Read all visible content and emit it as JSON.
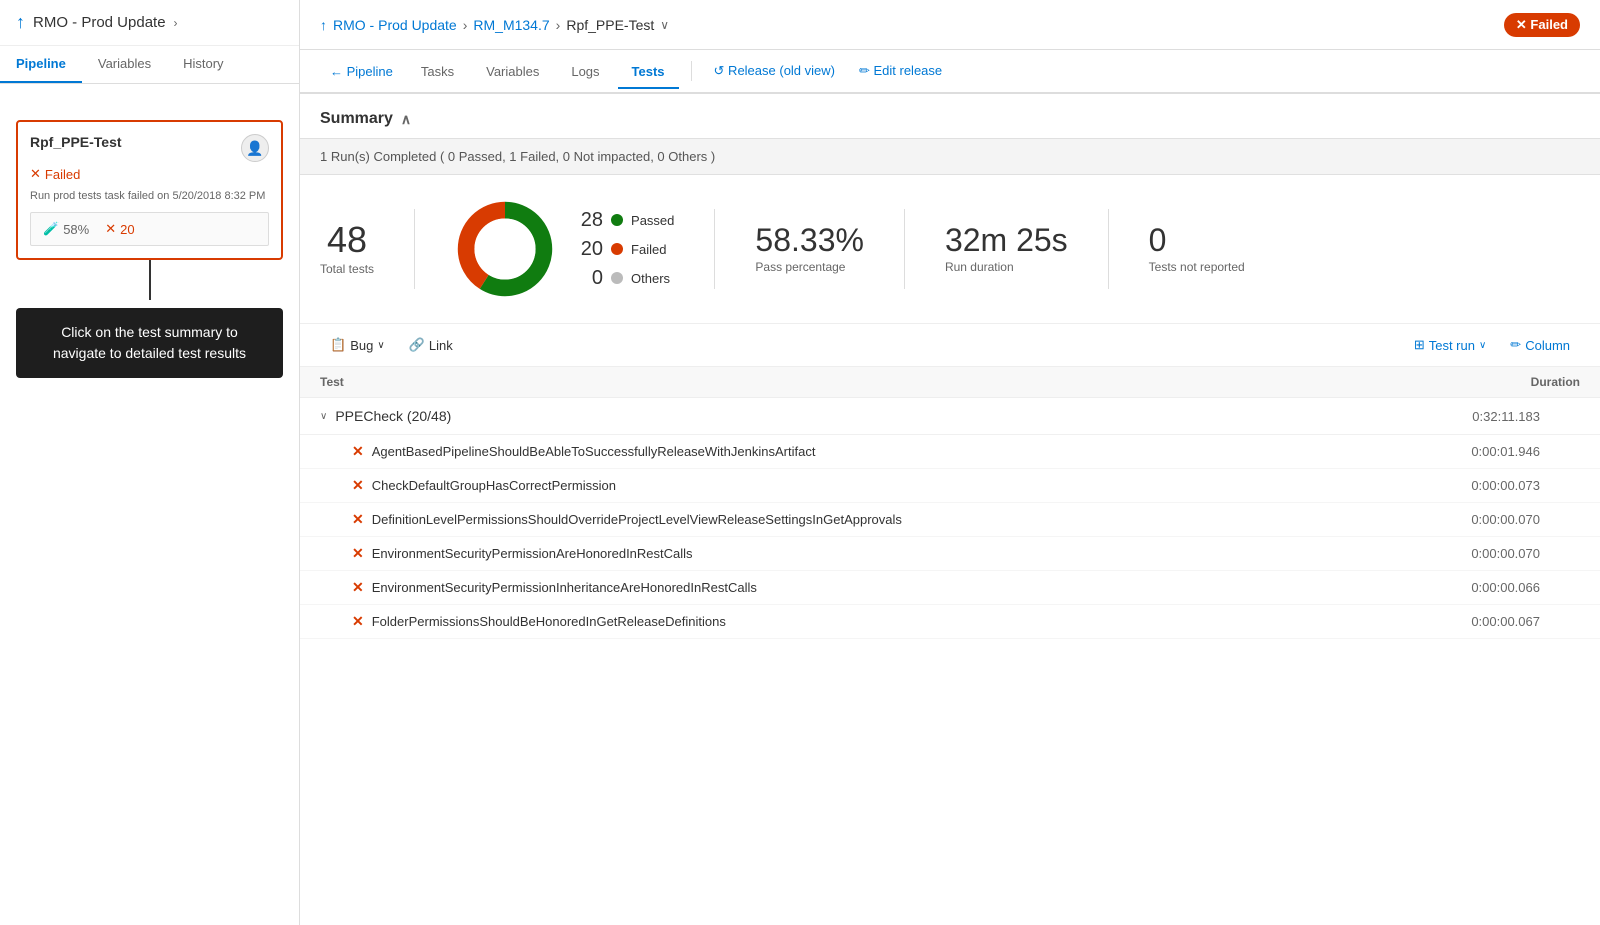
{
  "left": {
    "header_icon": "↑",
    "header_title": "RMO - Prod Update",
    "header_chevron": "›",
    "tabs": [
      "Pipeline",
      "Variables",
      "History"
    ],
    "active_tab": "Pipeline",
    "stage": {
      "name": "Rpf_PPE-Test",
      "status": "Failed",
      "fail_info": "Run prod tests task failed on 5/20/2018 8:32 PM",
      "pass_pct": "58%",
      "fail_count": "20"
    },
    "tooltip": "Click on the test summary to navigate to detailed test results"
  },
  "right": {
    "breadcrumb": {
      "icon": "↑",
      "items": [
        "RMO - Prod Update",
        "RM_M134.7",
        "Rpf_PPE-Test"
      ],
      "failed_label": "✕ Failed"
    },
    "nav": {
      "back_label": "← Pipeline",
      "items": [
        "Tasks",
        "Variables",
        "Logs",
        "Tests"
      ],
      "active_item": "Tests",
      "release_old": "↺  Release (old view)",
      "edit_release": "✏ Edit release"
    },
    "summary_label": "Summary",
    "run_banner": "1 Run(s) Completed ( 0 Passed, 1 Failed, 0 Not impacted, 0 Others )",
    "stats": {
      "total": "48",
      "total_label": "Total tests",
      "passed": "28",
      "failed": "20",
      "others": "0",
      "pass_pct": "58.33%",
      "pass_pct_label": "Pass percentage",
      "run_duration": "32m 25s",
      "run_duration_label": "Run duration",
      "not_reported": "0",
      "not_reported_label": "Tests not reported"
    },
    "legend": {
      "passed_label": "Passed",
      "failed_label": "Failed",
      "others_label": "Others"
    },
    "toolbar": {
      "bug_label": "Bug",
      "link_label": "Link",
      "test_run_label": "Test run",
      "column_label": "Column"
    },
    "table": {
      "col_test": "Test",
      "col_duration": "Duration",
      "groups": [
        {
          "name": "PPECheck (20/48)",
          "duration": "0:32:11.183",
          "tests": [
            {
              "name": "AgentBasedPipelineShouldBeAbleToSuccessfullyReleaseWithJenkinsArtifact",
              "duration": "0:00:01.946"
            },
            {
              "name": "CheckDefaultGroupHasCorrectPermission",
              "duration": "0:00:00.073"
            },
            {
              "name": "DefinitionLevelPermissionsShouldOverrideProjectLevelViewReleaseSettingsInGetApprovals",
              "duration": "0:00:00.070"
            },
            {
              "name": "EnvironmentSecurityPermissionAreHonoredInRestCalls",
              "duration": "0:00:00.070"
            },
            {
              "name": "EnvironmentSecurityPermissionInheritanceAreHonoredInRestCalls",
              "duration": "0:00:00.066"
            },
            {
              "name": "FolderPermissionsShouldBeHonoredInGetReleaseDefinitions",
              "duration": "0:00:00.067"
            }
          ]
        }
      ]
    }
  }
}
